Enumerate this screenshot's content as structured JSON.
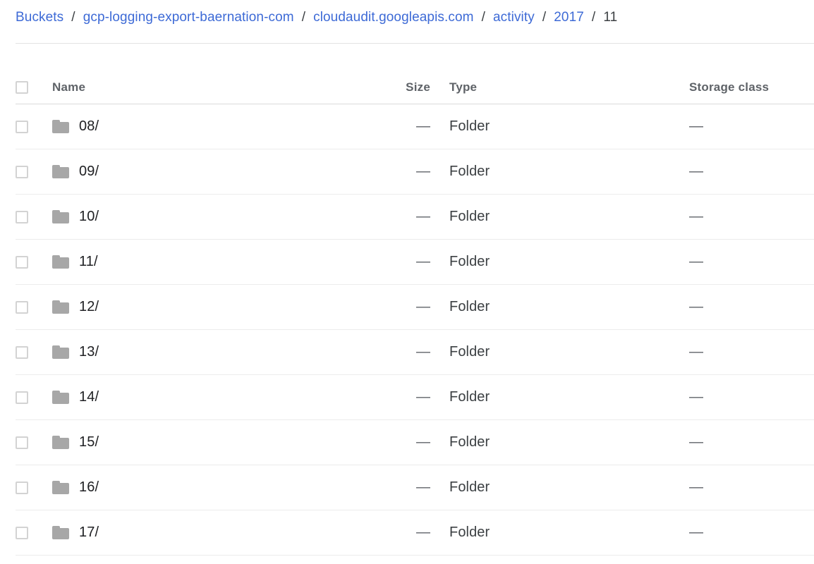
{
  "breadcrumb": {
    "separator": "/",
    "items": [
      {
        "label": "Buckets",
        "is_link": true
      },
      {
        "label": "gcp-logging-export-baernation-com",
        "is_link": true
      },
      {
        "label": "cloudaudit.googleapis.com",
        "is_link": true
      },
      {
        "label": "activity",
        "is_link": true
      },
      {
        "label": "2017",
        "is_link": true
      },
      {
        "label": "11",
        "is_link": false
      }
    ]
  },
  "colors": {
    "link": "#3d6ad6",
    "text": "#202124",
    "muted": "#5f6368",
    "folder_icon": "#a7a7a7",
    "divider": "#ececec",
    "checkbox_border": "#d3d3d3"
  },
  "table": {
    "columns": [
      {
        "key": "name",
        "label": "Name",
        "align": "left"
      },
      {
        "key": "size",
        "label": "Size",
        "align": "right"
      },
      {
        "key": "type",
        "label": "Type",
        "align": "left"
      },
      {
        "key": "storage_class",
        "label": "Storage class",
        "align": "left"
      }
    ],
    "select_all_checkbox": {
      "checked": false
    },
    "rows": [
      {
        "name": "08/",
        "icon": "folder-icon",
        "size": "—",
        "type": "Folder",
        "storage_class": "—",
        "checked": false
      },
      {
        "name": "09/",
        "icon": "folder-icon",
        "size": "—",
        "type": "Folder",
        "storage_class": "—",
        "checked": false
      },
      {
        "name": "10/",
        "icon": "folder-icon",
        "size": "—",
        "type": "Folder",
        "storage_class": "—",
        "checked": false
      },
      {
        "name": "11/",
        "icon": "folder-icon",
        "size": "—",
        "type": "Folder",
        "storage_class": "—",
        "checked": false
      },
      {
        "name": "12/",
        "icon": "folder-icon",
        "size": "—",
        "type": "Folder",
        "storage_class": "—",
        "checked": false
      },
      {
        "name": "13/",
        "icon": "folder-icon",
        "size": "—",
        "type": "Folder",
        "storage_class": "—",
        "checked": false
      },
      {
        "name": "14/",
        "icon": "folder-icon",
        "size": "—",
        "type": "Folder",
        "storage_class": "—",
        "checked": false
      },
      {
        "name": "15/",
        "icon": "folder-icon",
        "size": "—",
        "type": "Folder",
        "storage_class": "—",
        "checked": false
      },
      {
        "name": "16/",
        "icon": "folder-icon",
        "size": "—",
        "type": "Folder",
        "storage_class": "—",
        "checked": false
      },
      {
        "name": "17/",
        "icon": "folder-icon",
        "size": "—",
        "type": "Folder",
        "storage_class": "—",
        "checked": false
      }
    ]
  }
}
